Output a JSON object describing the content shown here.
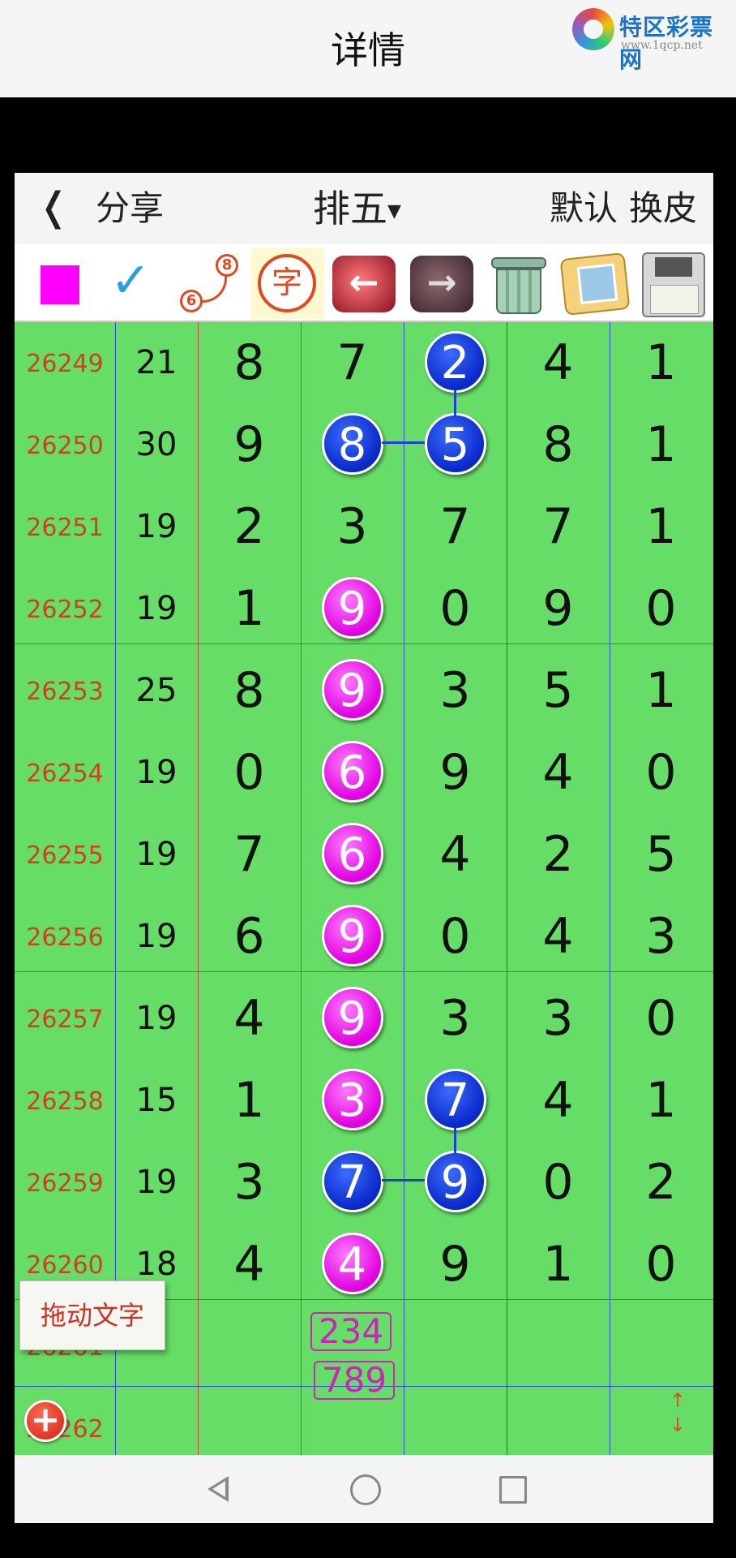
{
  "titlebar": {
    "title": "详情"
  },
  "logo": {
    "name": "特区彩票网",
    "url": "www.1qcp.net"
  },
  "toolbar": {
    "back_icon": "chevron-left-icon",
    "share_label": "分享",
    "lottery_name": "排五",
    "default_label": "默认",
    "skin_label": "换皮"
  },
  "iconbar": {
    "color_swatch": "#ff00ff",
    "icons": [
      "color-swatch-icon",
      "pen-check-icon",
      "connect-68-icon",
      "zi-text-icon",
      "arrow-left-icon",
      "arrow-right-icon",
      "trash-icon",
      "photo-icon",
      "save-disk-icon"
    ],
    "zi_label": "字",
    "connect_a": "6",
    "connect_b": "8"
  },
  "rows": [
    {
      "issue": "26249",
      "sum": "21",
      "digits": [
        "8",
        "7",
        "2",
        "4",
        "1"
      ],
      "balls": [
        null,
        null,
        "blue",
        null,
        null
      ]
    },
    {
      "issue": "26250",
      "sum": "30",
      "digits": [
        "9",
        "8",
        "5",
        "8",
        "1"
      ],
      "balls": [
        null,
        "blue",
        "blue",
        null,
        null
      ]
    },
    {
      "issue": "26251",
      "sum": "19",
      "digits": [
        "2",
        "3",
        "7",
        "7",
        "1"
      ],
      "balls": [
        null,
        null,
        null,
        null,
        null
      ]
    },
    {
      "issue": "26252",
      "sum": "19",
      "digits": [
        "1",
        "9",
        "0",
        "9",
        "0"
      ],
      "balls": [
        null,
        "pink",
        null,
        null,
        null
      ]
    },
    {
      "issue": "26253",
      "sum": "25",
      "digits": [
        "8",
        "9",
        "3",
        "5",
        "1"
      ],
      "balls": [
        null,
        "pink",
        null,
        null,
        null
      ]
    },
    {
      "issue": "26254",
      "sum": "19",
      "digits": [
        "0",
        "6",
        "9",
        "4",
        "0"
      ],
      "balls": [
        null,
        "pink",
        null,
        null,
        null
      ]
    },
    {
      "issue": "26255",
      "sum": "19",
      "digits": [
        "7",
        "6",
        "4",
        "2",
        "5"
      ],
      "balls": [
        null,
        "pink",
        null,
        null,
        null
      ]
    },
    {
      "issue": "26256",
      "sum": "19",
      "digits": [
        "6",
        "9",
        "0",
        "4",
        "3"
      ],
      "balls": [
        null,
        "pink",
        null,
        null,
        null
      ]
    },
    {
      "issue": "26257",
      "sum": "19",
      "digits": [
        "4",
        "9",
        "3",
        "3",
        "0"
      ],
      "balls": [
        null,
        "pink",
        null,
        null,
        null
      ]
    },
    {
      "issue": "26258",
      "sum": "15",
      "digits": [
        "1",
        "3",
        "7",
        "4",
        "1"
      ],
      "balls": [
        null,
        "pink",
        "blue",
        null,
        null
      ]
    },
    {
      "issue": "26259",
      "sum": "19",
      "digits": [
        "3",
        "7",
        "9",
        "0",
        "2"
      ],
      "balls": [
        null,
        "blue",
        "blue",
        null,
        null
      ]
    },
    {
      "issue": "26260",
      "sum": "18",
      "digits": [
        "4",
        "4",
        "9",
        "1",
        "0"
      ],
      "balls": [
        null,
        "pink",
        null,
        null,
        null
      ]
    },
    {
      "issue": "26261",
      "sum": "",
      "digits": [
        "",
        "",
        "",
        "",
        ""
      ],
      "balls": [
        null,
        null,
        null,
        null,
        null
      ]
    },
    {
      "issue": "26262",
      "sum": "",
      "digits": [
        "",
        "",
        "",
        "",
        ""
      ],
      "balls": [
        null,
        null,
        null,
        null,
        null
      ]
    }
  ],
  "hints": [
    "234",
    "789"
  ],
  "drag_button": {
    "label": "拖动文字"
  },
  "add_button": {
    "icon": "plus-icon",
    "label": "+"
  },
  "scroll_handle": {
    "icon": "resize-vertical-icon"
  },
  "colors": {
    "background_green": "#66dd66",
    "issue_red": "#d04020",
    "ball_pink": "#e000e0",
    "ball_blue": "#0a28c8",
    "grid_red": "#d04040",
    "grid_blue": "#3050d0"
  },
  "navbar": {
    "icons": [
      "nav-back-icon",
      "nav-home-icon",
      "nav-recent-icon"
    ]
  }
}
